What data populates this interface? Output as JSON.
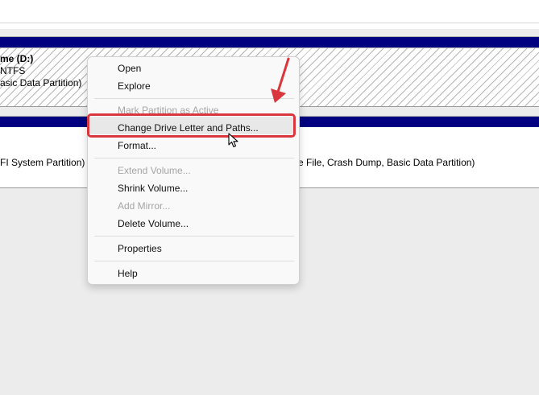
{
  "partition_d": {
    "name": "me  (D:)",
    "filesystem": "NTFS",
    "status": "asic Data Partition)"
  },
  "partition_efi": {
    "status": "FI System Partition)"
  },
  "partition_c": {
    "status": "e File, Crash Dump, Basic Data Partition)"
  },
  "context_menu": {
    "open": "Open",
    "explore": "Explore",
    "mark_active": "Mark Partition as Active",
    "change_drive_letter": "Change Drive Letter and Paths...",
    "format": "Format...",
    "extend_volume": "Extend Volume...",
    "shrink_volume": "Shrink Volume...",
    "add_mirror": "Add Mirror...",
    "delete_volume": "Delete Volume...",
    "properties": "Properties",
    "help": "Help"
  },
  "colors": {
    "partition_bar": "#000080",
    "annotation_red": "#d9363e"
  },
  "icons": {
    "annotation_arrow": "red-arrow-icon",
    "pointer": "mouse-pointer-icon"
  }
}
